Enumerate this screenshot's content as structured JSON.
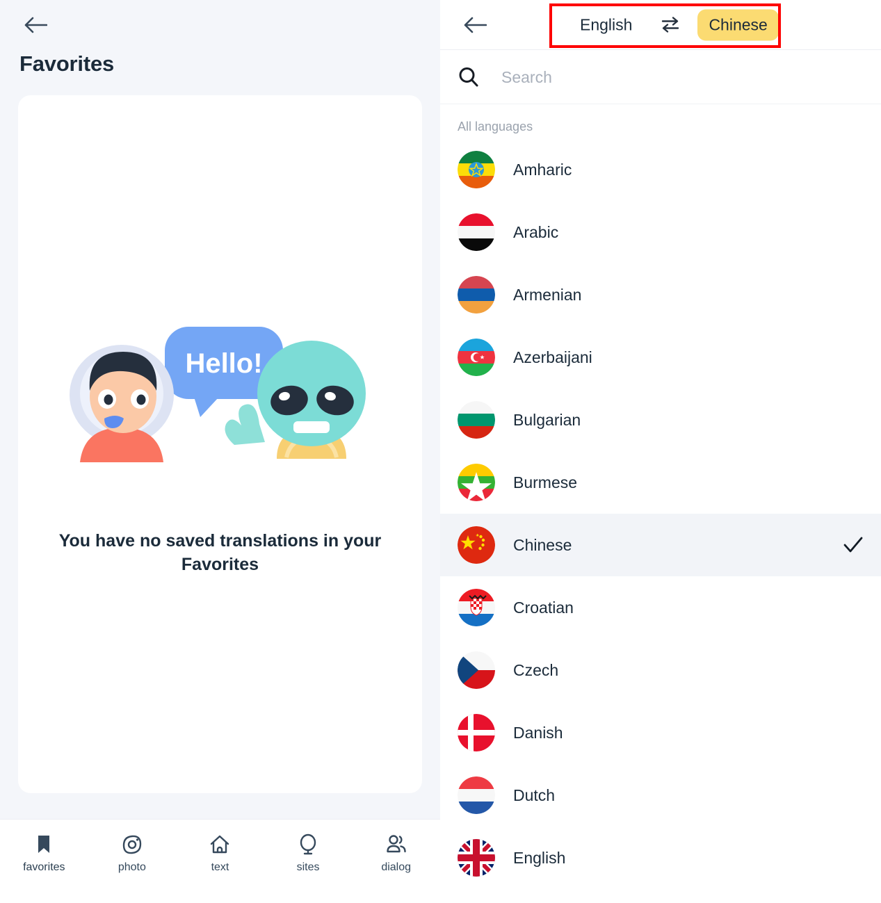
{
  "left": {
    "back_icon": "arrow-left-icon",
    "title": "Favorites",
    "empty_state": {
      "illustration": "astronaut-and-alien-illustration",
      "speech_bubble_text": "Hello!",
      "message": "You have no saved translations in your Favorites"
    },
    "bottom_nav": [
      {
        "label": "favorites",
        "icon": "bookmark-icon",
        "active": true
      },
      {
        "label": "photo",
        "icon": "camera-icon",
        "active": false
      },
      {
        "label": "text",
        "icon": "home-translate-icon",
        "active": false
      },
      {
        "label": "sites",
        "icon": "globe-icon",
        "active": false
      },
      {
        "label": "dialog",
        "icon": "people-icon",
        "active": false
      }
    ]
  },
  "right": {
    "back_icon": "arrow-left-icon",
    "source_language": "English",
    "swap_icon": "swap-arrows-icon",
    "target_language": "Chinese",
    "search": {
      "icon": "search-icon",
      "placeholder": "Search",
      "value": ""
    },
    "section_label": "All languages",
    "selected_language": "Chinese",
    "check_icon": "checkmark-icon",
    "languages": [
      {
        "name": "Amharic",
        "flag": "ethiopia-flag",
        "selected": false
      },
      {
        "name": "Arabic",
        "flag": "yemen-flag",
        "selected": false
      },
      {
        "name": "Armenian",
        "flag": "armenia-flag",
        "selected": false
      },
      {
        "name": "Azerbaijani",
        "flag": "azerbaijan-flag",
        "selected": false
      },
      {
        "name": "Bulgarian",
        "flag": "bulgaria-flag",
        "selected": false
      },
      {
        "name": "Burmese",
        "flag": "myanmar-flag",
        "selected": false
      },
      {
        "name": "Chinese",
        "flag": "china-flag",
        "selected": true
      },
      {
        "name": "Croatian",
        "flag": "croatia-flag",
        "selected": false
      },
      {
        "name": "Czech",
        "flag": "czech-flag",
        "selected": false
      },
      {
        "name": "Danish",
        "flag": "denmark-flag",
        "selected": false
      },
      {
        "name": "Dutch",
        "flag": "netherlands-flag",
        "selected": false
      },
      {
        "name": "English",
        "flag": "uk-flag",
        "selected": false
      }
    ]
  },
  "annotation": {
    "color": "#fe0000",
    "target": "language-switcher"
  },
  "colors": {
    "accent_yellow": "#fbdb72",
    "text_dark": "#1b2b3a",
    "muted": "#9aa2ad",
    "panel_bg": "#f4f6fa",
    "selected_row": "#f2f4f8"
  }
}
